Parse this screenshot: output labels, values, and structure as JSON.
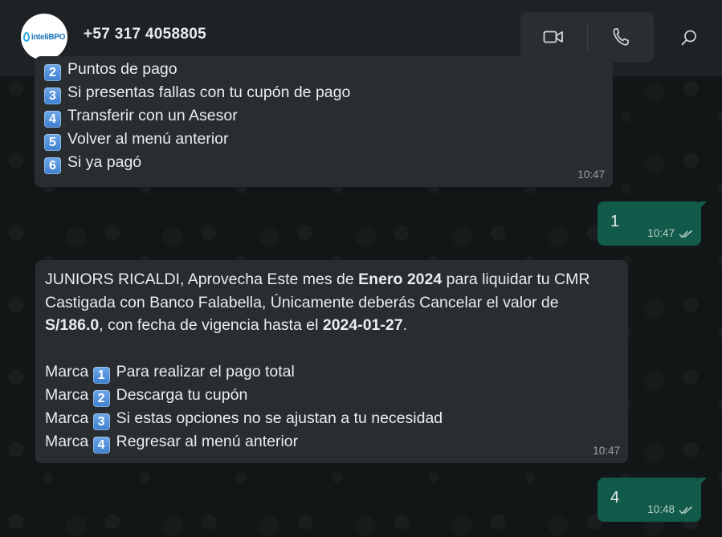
{
  "header": {
    "avatar_logo_text": "inteliBPO",
    "contact_name": "+57 317 4058805"
  },
  "messages": [
    {
      "direction": "incoming",
      "lines": [
        {
          "key": "2",
          "text": "Puntos de pago"
        },
        {
          "key": "3",
          "text": "Si presentas fallas con tu cupón de pago"
        },
        {
          "key": "4",
          "text": "Transferir con un Asesor"
        },
        {
          "key": "5",
          "text": "Volver al menú anterior"
        },
        {
          "key": "6",
          "text": "Si ya pagó"
        }
      ],
      "time": "10:47"
    },
    {
      "direction": "outgoing",
      "text": "1",
      "time": "10:47",
      "status": "read-double-check"
    },
    {
      "direction": "incoming",
      "p1": {
        "a": "JUNIORS RICALDI, Aprovecha Este mes de ",
        "b": "Enero 2024",
        "c": " para liquidar tu CMR",
        "d": "Castigada con Banco Falabella, Únicamente deberás Cancelar el valor de",
        "e": "S/186.0",
        "f": ", con fecha de vigencia hasta el ",
        "g": "2024-01-27",
        "h": "."
      },
      "options": [
        {
          "prefix": "Marca",
          "key": "1",
          "text": "Para realizar el pago total"
        },
        {
          "prefix": "Marca",
          "key": "2",
          "text": "Descarga tu cupón"
        },
        {
          "prefix": "Marca",
          "key": "3",
          "text": "Si estas opciones no se ajustan a tu necesidad"
        },
        {
          "prefix": "Marca",
          "key": "4",
          "text": "Regresar al menú anterior"
        }
      ],
      "time": "10:47"
    },
    {
      "direction": "outgoing",
      "text": "4",
      "time": "10:48",
      "status": "read-double-check"
    }
  ],
  "colors": {
    "header_bg": "#1f2224",
    "incoming_bubble": "#2a2d2f",
    "outgoing_bubble": "#125a4a",
    "read_tick": "#b8d0ca"
  },
  "icons": {
    "video_call": "video-camera-icon",
    "voice_call": "phone-icon",
    "search": "search-icon"
  }
}
